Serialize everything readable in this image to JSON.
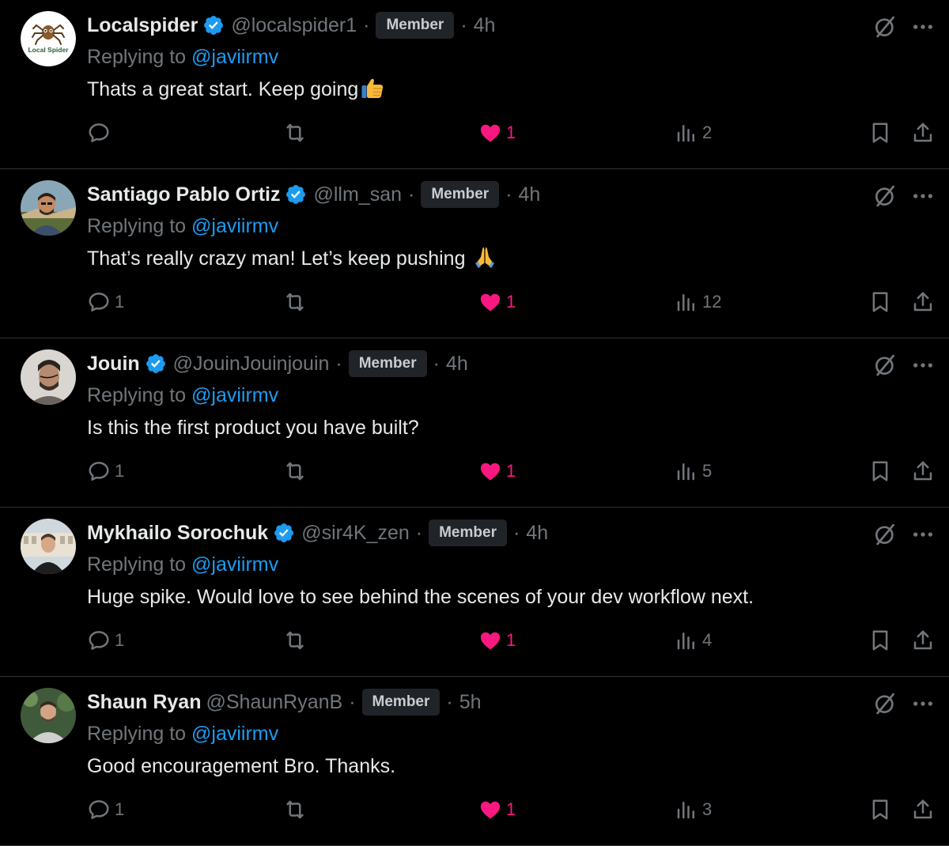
{
  "replies": [
    {
      "name": "Localspider",
      "handle": "@localspider1",
      "verified": true,
      "badge": "Member",
      "time": "4h",
      "replying_label": "Replying to",
      "replying_to": "@javiirmv",
      "text": "Thats a great start. Keep going",
      "emoji": "thumbs-up-emoji",
      "avatar_text": "Local Spider",
      "reply_count": "",
      "like_count": "1",
      "view_count": "2"
    },
    {
      "name": "Santiago Pablo Ortiz",
      "handle": "@llm_san",
      "verified": true,
      "badge": "Member",
      "time": "4h",
      "replying_label": "Replying to",
      "replying_to": "@javiirmv",
      "text": "That’s really crazy man! Let’s keep pushing",
      "emoji": "folded-hands-emoji",
      "reply_count": "1",
      "like_count": "1",
      "view_count": "12"
    },
    {
      "name": "Jouin",
      "handle": "@JouinJouinjouin",
      "verified": true,
      "badge": "Member",
      "time": "4h",
      "replying_label": "Replying to",
      "replying_to": "@javiirmv",
      "text": "Is this the first product you have built?",
      "reply_count": "1",
      "like_count": "1",
      "view_count": "5"
    },
    {
      "name": "Mykhailo Sorochuk",
      "handle": "@sir4K_zen",
      "verified": true,
      "badge": "Member",
      "time": "4h",
      "replying_label": "Replying to",
      "replying_to": "@javiirmv",
      "text": "Huge spike. Would love to see behind the scenes of your dev workflow next.",
      "reply_count": "1",
      "like_count": "1",
      "view_count": "4"
    },
    {
      "name": "Shaun Ryan",
      "handle": "@ShaunRyanB",
      "verified": false,
      "badge": "Member",
      "time": "5h",
      "replying_label": "Replying to",
      "replying_to": "@javiirmv",
      "text": "Good encouragement Bro. Thanks.",
      "reply_count": "1",
      "like_count": "1",
      "view_count": "3"
    }
  ],
  "colors": {
    "background": "#000000",
    "text": "#e7e9ea",
    "muted": "#71767b",
    "link": "#1d9bf0",
    "like": "#f91880",
    "verified": "#1d9bf0",
    "divider": "#2f3336",
    "badge_bg": "#202327"
  },
  "icons": [
    "grok-icon",
    "more-icon",
    "reply-icon",
    "repost-icon",
    "like-icon",
    "views-icon",
    "bookmark-icon",
    "share-icon",
    "verified-icon"
  ]
}
